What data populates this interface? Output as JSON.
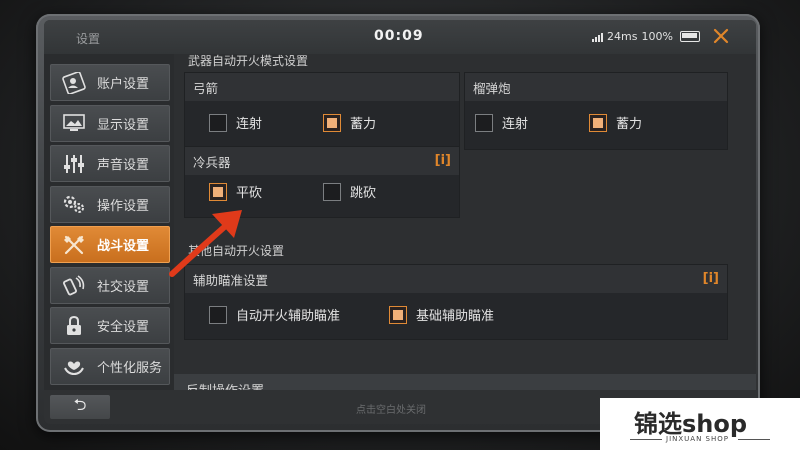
{
  "topbar": {
    "title": "设置",
    "clock": "00:09",
    "ping": "24ms",
    "battery": "100%",
    "close_icon": "close-icon"
  },
  "sidebar": {
    "items": [
      {
        "label": "账户设置",
        "icon": "account-icon",
        "active": false
      },
      {
        "label": "显示设置",
        "icon": "display-icon",
        "active": false
      },
      {
        "label": "声音设置",
        "icon": "sound-icon",
        "active": false
      },
      {
        "label": "操作设置",
        "icon": "controls-icon",
        "active": false
      },
      {
        "label": "战斗设置",
        "icon": "combat-icon",
        "active": true
      },
      {
        "label": "社交设置",
        "icon": "social-icon",
        "active": false
      },
      {
        "label": "安全设置",
        "icon": "security-icon",
        "active": false
      },
      {
        "label": "个性化服务",
        "icon": "personalization-icon",
        "active": false
      }
    ]
  },
  "main": {
    "section_weapon_auto_fire": "武器自动开火模式设置",
    "panels": {
      "bow": {
        "title": "弓箭",
        "options": [
          {
            "label": "连射",
            "checked": false
          },
          {
            "label": "蓄力",
            "checked": true
          }
        ]
      },
      "grenade_launcher": {
        "title": "榴弹炮",
        "options": [
          {
            "label": "连射",
            "checked": false
          },
          {
            "label": "蓄力",
            "checked": true
          }
        ]
      },
      "melee": {
        "title": "冷兵器",
        "info": "i",
        "options": [
          {
            "label": "平砍",
            "checked": true
          },
          {
            "label": "跳砍",
            "checked": false
          }
        ]
      },
      "assist_aim": {
        "title": "辅助瞄准设置",
        "info": "i",
        "options": [
          {
            "label": "自动开火辅助瞄准",
            "checked": false
          },
          {
            "label": "基础辅助瞄准",
            "checked": true
          }
        ]
      }
    },
    "section_other_auto_fire": "其他自动开火设置",
    "counter_settings": "反制操作设置"
  },
  "footer": {
    "back_icon": "back-arrow-icon",
    "back_glyph": "⮌",
    "hint": "点击空白处关闭"
  },
  "watermark": {
    "brand": "锦选shop",
    "sub": "JINXUAN SHOP"
  },
  "colors": {
    "accent": "#e08a36",
    "arrow": "#e03a1a"
  }
}
